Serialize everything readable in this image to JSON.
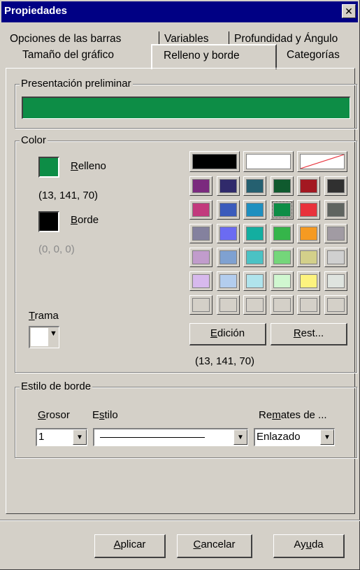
{
  "window": {
    "title": "Propiedades",
    "close_symbol": "✕"
  },
  "tabs": {
    "row1": [
      "Opciones de las barras",
      "Variables",
      "Profundidad y Ángulo"
    ],
    "row2": [
      "Tamaño del gráfico",
      "Relleno y borde",
      "Categorías"
    ],
    "active": "Relleno y borde"
  },
  "preview": {
    "legend": "Presentación preliminar",
    "color": "#0d8d46"
  },
  "color_group": {
    "legend": "Color",
    "fill": {
      "label_first": "R",
      "label_rest": "elleno",
      "rgb_text": "(13, 141, 70)",
      "color": "#0d8d46"
    },
    "border": {
      "label_first": "B",
      "label_rest": "orde",
      "rgb_text": "(0, 0, 0)",
      "color": "#000000"
    },
    "pattern": {
      "label_first": "T",
      "label_rest": "rama",
      "dropdown_arrow": "▼"
    },
    "palette_top": [
      "#000000",
      "#ffffff",
      "none"
    ],
    "palette_rows": [
      [
        "#7b2a7e",
        "#302a6b",
        "#256070",
        "#0f5a2e",
        "#a31821",
        "#303030"
      ],
      [
        "#c23a7d",
        "#3b5bbb",
        "#1e8fbf",
        "#0d8d46",
        "#e8323c",
        "#5f6460"
      ],
      [
        "#84819e",
        "#6b6bf2",
        "#13aea0",
        "#35b54a",
        "#f59a22",
        "#a19ba3"
      ],
      [
        "#c19ccc",
        "#7fa1d1",
        "#4bc2c4",
        "#74d67a",
        "#d3d08a",
        "#d0d0d0"
      ],
      [
        "#d7b9ed",
        "#b3cdee",
        "#b0e4ec",
        "#d0f7d0",
        "#fdf37e",
        "#dfe4df"
      ],
      [
        "#d4d0c8",
        "#d4d0c8",
        "#d4d0c8",
        "#d4d0c8",
        "#d4d0c8",
        "#d4d0c8"
      ]
    ],
    "selected": "#0d8d46",
    "edit_button": {
      "first": "E",
      "rest": "dición"
    },
    "reset_button": {
      "first": "R",
      "rest": "est..."
    },
    "selected_rgb_text": "(13, 141, 70)"
  },
  "border_style": {
    "legend": "Estilo de borde",
    "thickness": {
      "label_first": "G",
      "label_rest": "rosor",
      "value": "1"
    },
    "style": {
      "label_first": "E",
      "label_mid": "s",
      "label_rest": "tilo"
    },
    "caps": {
      "label_first": "Re",
      "label_mid": "m",
      "label_rest": "ates de ...",
      "value": "Enlazado"
    }
  },
  "footer": {
    "apply": {
      "first": "A",
      "rest": "plicar"
    },
    "cancel": {
      "first": "C",
      "rest": "ancelar"
    },
    "help": {
      "first": "Ay",
      "mid": "u",
      "rest": "da"
    }
  }
}
